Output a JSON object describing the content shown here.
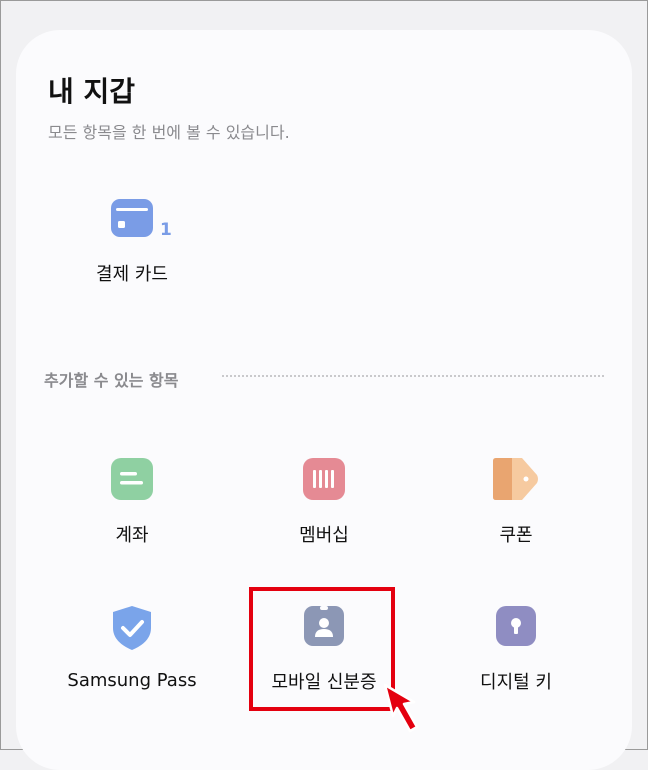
{
  "header": {
    "title": "내 지갑",
    "subtitle": "모든 항목을 한 번에 볼 수 있습니다."
  },
  "my_items": [
    {
      "label": "결제 카드",
      "count": "1",
      "icon": "card-icon",
      "color": "#7a9ce6"
    }
  ],
  "addable_section": {
    "title": "추가할 수 있는 항목",
    "items": [
      {
        "label": "계좌",
        "icon": "account-icon",
        "color": "#8fd0a2"
      },
      {
        "label": "멤버십",
        "icon": "membership-icon",
        "color": "#e58a94"
      },
      {
        "label": "쿠폰",
        "icon": "coupon-icon",
        "color": "#f1b888"
      },
      {
        "label": "Samsung Pass",
        "icon": "shield-check-icon",
        "color": "#7aa4ea"
      },
      {
        "label": "모바일 신분증",
        "icon": "id-card-icon",
        "color": "#8c97b5",
        "highlighted": true
      },
      {
        "label": "디지털 키",
        "icon": "digital-key-icon",
        "color": "#8f8dc2"
      }
    ]
  },
  "annotation": {
    "highlight_color": "#e4000f",
    "pointer_icon": "red-arrow-cursor-icon"
  }
}
